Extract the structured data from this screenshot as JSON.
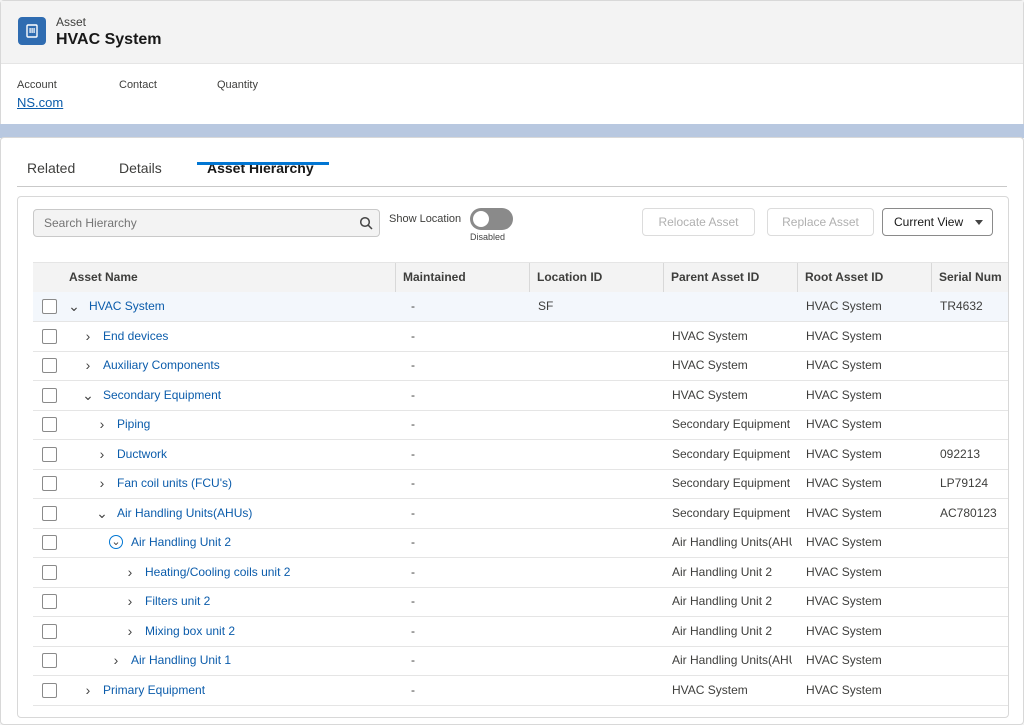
{
  "header": {
    "object_type": "Asset",
    "title": "HVAC System",
    "fields": [
      {
        "label": "Account",
        "value": "NS.com"
      },
      {
        "label": "Contact",
        "value": ""
      },
      {
        "label": "Quantity",
        "value": ""
      }
    ]
  },
  "tabs": [
    {
      "label": "Related",
      "active": false
    },
    {
      "label": "Details",
      "active": false
    },
    {
      "label": "Asset Hierarchy",
      "active": true
    }
  ],
  "toolbar": {
    "search_placeholder": "Search Hierarchy",
    "show_location_label": "Show Location",
    "show_location_state": "Disabled",
    "relocate_label": "Relocate Asset",
    "replace_label": "Replace Asset",
    "view_label": "Current View"
  },
  "table": {
    "columns": [
      "Asset Name",
      "Maintained",
      "Location ID",
      "Parent Asset ID",
      "Root Asset ID",
      "Serial Num"
    ],
    "rows": [
      {
        "name": "HVAC System",
        "maintained": "-",
        "location": "SF",
        "parent": "",
        "root": "HVAC System",
        "serial": "TR4632",
        "expanded": true
      },
      {
        "name": "End devices",
        "maintained": "-",
        "location": "",
        "parent": "HVAC System",
        "root": "HVAC System",
        "serial": "",
        "expanded": false
      },
      {
        "name": "Auxiliary Components",
        "maintained": "-",
        "location": "",
        "parent": "HVAC System",
        "root": "HVAC System",
        "serial": "",
        "expanded": false
      },
      {
        "name": "Secondary Equipment",
        "maintained": "-",
        "location": "",
        "parent": "HVAC System",
        "root": "HVAC System",
        "serial": "",
        "expanded": true
      },
      {
        "name": "Piping",
        "maintained": "-",
        "location": "",
        "parent": "Secondary Equipment",
        "root": "HVAC System",
        "serial": "",
        "expanded": false
      },
      {
        "name": "Ductwork",
        "maintained": "-",
        "location": "",
        "parent": "Secondary Equipment",
        "root": "HVAC System",
        "serial": "092213",
        "expanded": false
      },
      {
        "name": "Fan coil units (FCU's)",
        "maintained": "-",
        "location": "",
        "parent": "Secondary Equipment",
        "root": "HVAC System",
        "serial": "LP79124",
        "expanded": false
      },
      {
        "name": "Air Handling Units(AHUs)",
        "maintained": "-",
        "location": "",
        "parent": "Secondary Equipment",
        "root": "HVAC System",
        "serial": "AC780123",
        "expanded": true
      },
      {
        "name": "Air Handling Unit 2",
        "maintained": "-",
        "location": "",
        "parent": "Air Handling Units(AHUs)",
        "root": "HVAC System",
        "serial": "",
        "expanded": true
      },
      {
        "name": "Heating/Cooling coils unit 2",
        "maintained": "-",
        "location": "",
        "parent": "Air Handling Unit 2",
        "root": "HVAC System",
        "serial": "",
        "expanded": false
      },
      {
        "name": "Filters unit 2",
        "maintained": "-",
        "location": "",
        "parent": "Air Handling Unit 2",
        "root": "HVAC System",
        "serial": "",
        "expanded": false
      },
      {
        "name": "Mixing box unit 2",
        "maintained": "-",
        "location": "",
        "parent": "Air Handling Unit 2",
        "root": "HVAC System",
        "serial": "",
        "expanded": false
      },
      {
        "name": "Air Handling Unit 1",
        "maintained": "-",
        "location": "",
        "parent": "Air Handling Units(AHUs)",
        "root": "HVAC System",
        "serial": "",
        "expanded": false
      },
      {
        "name": "Primary Equipment",
        "maintained": "-",
        "location": "",
        "parent": "HVAC System",
        "root": "HVAC System",
        "serial": "",
        "expanded": false
      }
    ]
  },
  "colors": {
    "link": "#0b5cab",
    "brand": "#0176d3",
    "icon_bg": "#2f6cb1"
  }
}
